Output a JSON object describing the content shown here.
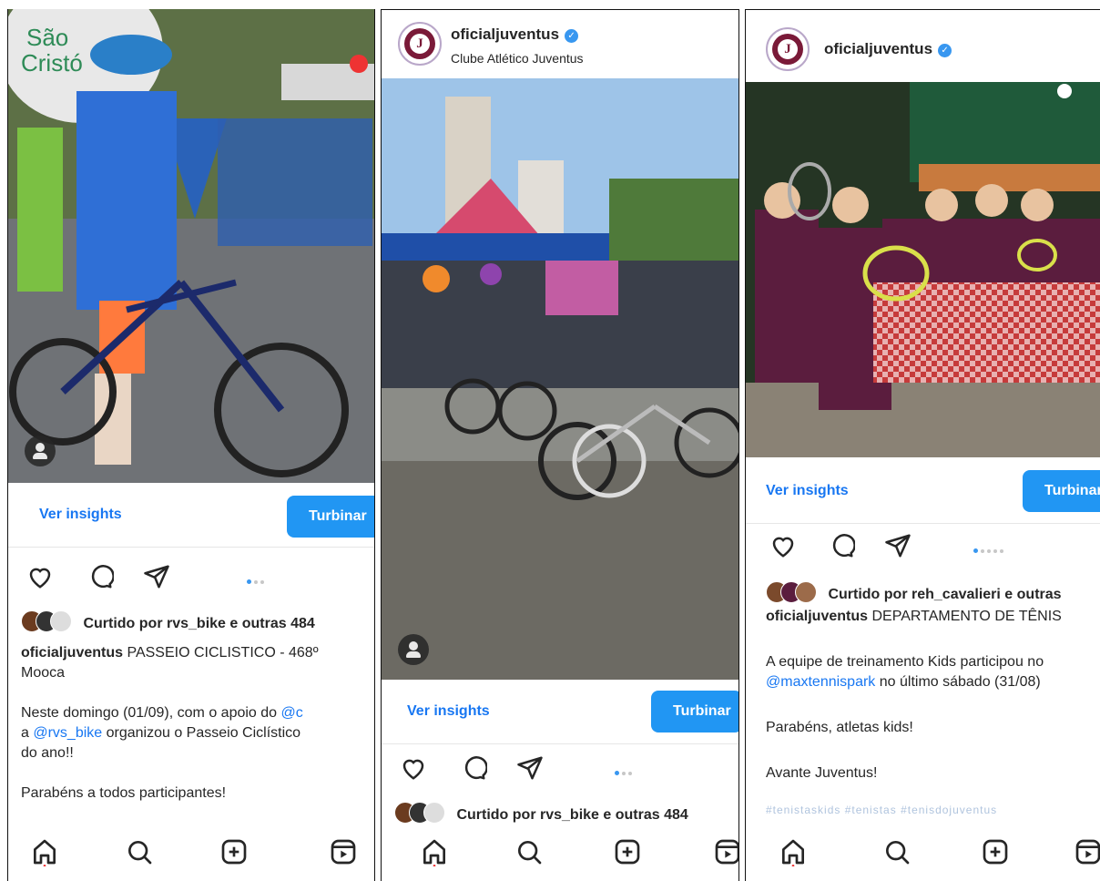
{
  "panels": [
    {
      "photo_alt": "",
      "insights_label": "Ver insights",
      "boost_label": "Turbinar",
      "liked_prefix": "Curtido por ",
      "liked_user": "rvs_bike",
      "liked_suffix": " e outras 484",
      "caption_user": "oficialjuventus",
      "caption_title": " PASSEIO CICLISTICO - 468º",
      "caption_title_cont": "Mooca",
      "p1_text_a": "Neste domingo (01/09), com o apoio do ",
      "p1_mention": "@c",
      "p2_text_a": "a ",
      "p2_mention": "@rvs_bike",
      "p2_text_b": " organizou o Passeio Ciclístico",
      "p2_text_c": "do ano!!",
      "p3_text": "Parabéns a todos participantes!"
    },
    {
      "account": "oficialjuventus",
      "subtitle": "Clube Atlético Juventus",
      "insights_label": "Ver insights",
      "boost_label": "Turbinar",
      "liked_prefix": "Curtido por ",
      "liked_user": "rvs_bike",
      "liked_suffix": " e outras 484"
    },
    {
      "account": "oficialjuventus",
      "insights_label": "Ver insights",
      "boost_label": "Turbinar",
      "liked_prefix": "Curtido por ",
      "liked_user": "reh_cavalieri",
      "liked_suffix": " e outras",
      "caption_user": "oficialjuventus",
      "caption_title": " DEPARTAMENTO DE TÊNIS",
      "p1_text_a": "A equipe de treinamento Kids participou no",
      "p1_mention": "@maxtennispark",
      "p1_text_b": " no último sábado (31/08)",
      "p2_text": "Parabéns, atletas kids!",
      "p3_text": "Avante Juventus!",
      "p4_text": "#tenistaskids #tenistas #tenisdojuventus"
    }
  ],
  "colors": {
    "accent": "#1877f2",
    "boost": "#2196f3",
    "brand": "#7a1a38"
  },
  "icons": [
    "like-heart-icon",
    "comment-icon",
    "share-icon",
    "home-icon",
    "search-icon",
    "create-post-icon",
    "reels-icon",
    "verified-badge-icon"
  ]
}
